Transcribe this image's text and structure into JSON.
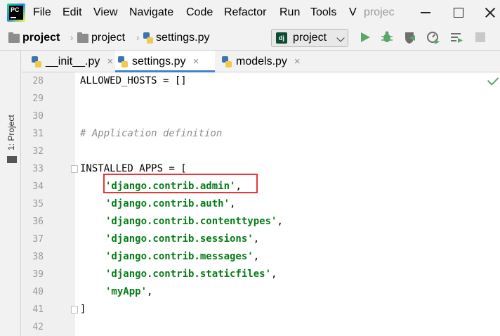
{
  "menu": {
    "items": [
      "File",
      "Edit",
      "View",
      "Navigate",
      "Code",
      "Refactor",
      "Run",
      "Tools",
      "V"
    ],
    "window_title": "projec"
  },
  "navbar": {
    "crumbs": [
      "project",
      "project",
      "settings.py"
    ],
    "run_config": "project",
    "dj_icon": "dj"
  },
  "sidebar": {
    "project_tool": "1: Project"
  },
  "tabs": [
    {
      "label": "__init__.py",
      "close": "×"
    },
    {
      "label": "settings.py",
      "close": "×"
    },
    {
      "label": "models.py",
      "close": "×"
    }
  ],
  "editor": {
    "lines": [
      {
        "num": "28",
        "text": "ALLOWED_HOSTS = []"
      },
      {
        "num": "29",
        "text": ""
      },
      {
        "num": "30",
        "text": ""
      },
      {
        "num": "31",
        "text": "# Application definition"
      },
      {
        "num": "32",
        "text": ""
      },
      {
        "num": "33",
        "text": "INSTALLED_APPS = ["
      },
      {
        "num": "34",
        "text": "'django.contrib.admin'",
        "suffix": ","
      },
      {
        "num": "35",
        "text": "'django.contrib.auth'",
        "suffix": ","
      },
      {
        "num": "36",
        "text": "'django.contrib.contenttypes'",
        "suffix": ","
      },
      {
        "num": "37",
        "text": "'django.contrib.sessions'",
        "suffix": ","
      },
      {
        "num": "38",
        "text": "'django.contrib.messages'",
        "suffix": ","
      },
      {
        "num": "39",
        "text": "'django.contrib.staticfiles'",
        "suffix": ","
      },
      {
        "num": "40",
        "text": "'myApp'",
        "suffix": ","
      },
      {
        "num": "41",
        "text": "]"
      },
      {
        "num": "42",
        "text": ""
      }
    ]
  },
  "colors": {
    "string": "#067d17",
    "comment": "#8c8c8c",
    "highlight_box": "#e53935",
    "tab_underline": "#4083c9"
  },
  "icons": [
    "pycharm-logo-icon",
    "folder-icon",
    "python-file-icon",
    "django-icon",
    "run-icon",
    "debug-icon",
    "coverage-icon",
    "profile-icon",
    "concurrency-icon",
    "stop-icon",
    "check-icon"
  ]
}
